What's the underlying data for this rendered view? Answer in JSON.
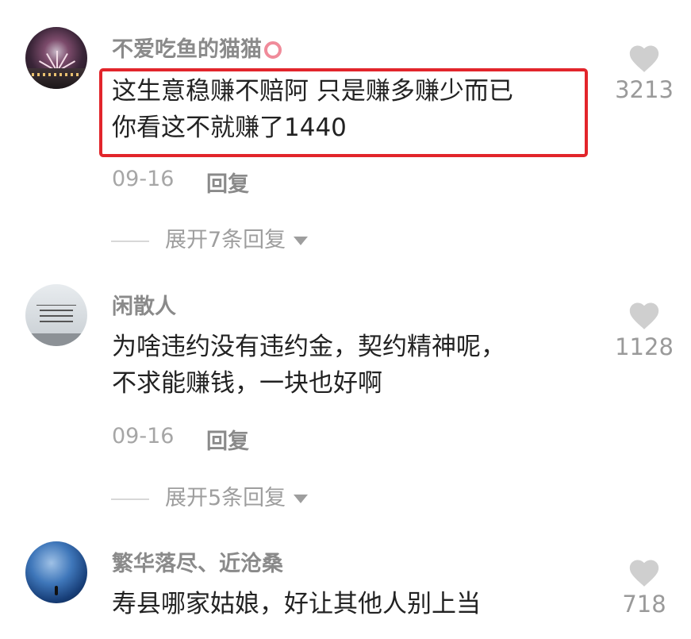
{
  "comments": [
    {
      "username": "不爱吃鱼的猫猫",
      "lines": [
        "这生意稳赚不赔阿 只是赚多赚少而已",
        "你看这不就赚了1440"
      ],
      "date": "09-16",
      "reply_label": "回复",
      "expand_label": "展开7条回复",
      "likes": "3213",
      "highlighted": true
    },
    {
      "username": "闲散人",
      "lines": [
        "为啥违约没有违约金，契约精神呢，",
        "不求能赚钱，一块也好啊"
      ],
      "date": "09-16",
      "reply_label": "回复",
      "expand_label": "展开5条回复",
      "likes": "1128"
    },
    {
      "username": "繁华落尽、近沧桑",
      "lines": [
        "寿县哪家姑娘，好让其他人别上当"
      ],
      "likes": "718"
    }
  ],
  "colors": {
    "highlight_border": "#e2252b",
    "like_icon": "#cfcfcf",
    "username": "#8a8a8a"
  }
}
